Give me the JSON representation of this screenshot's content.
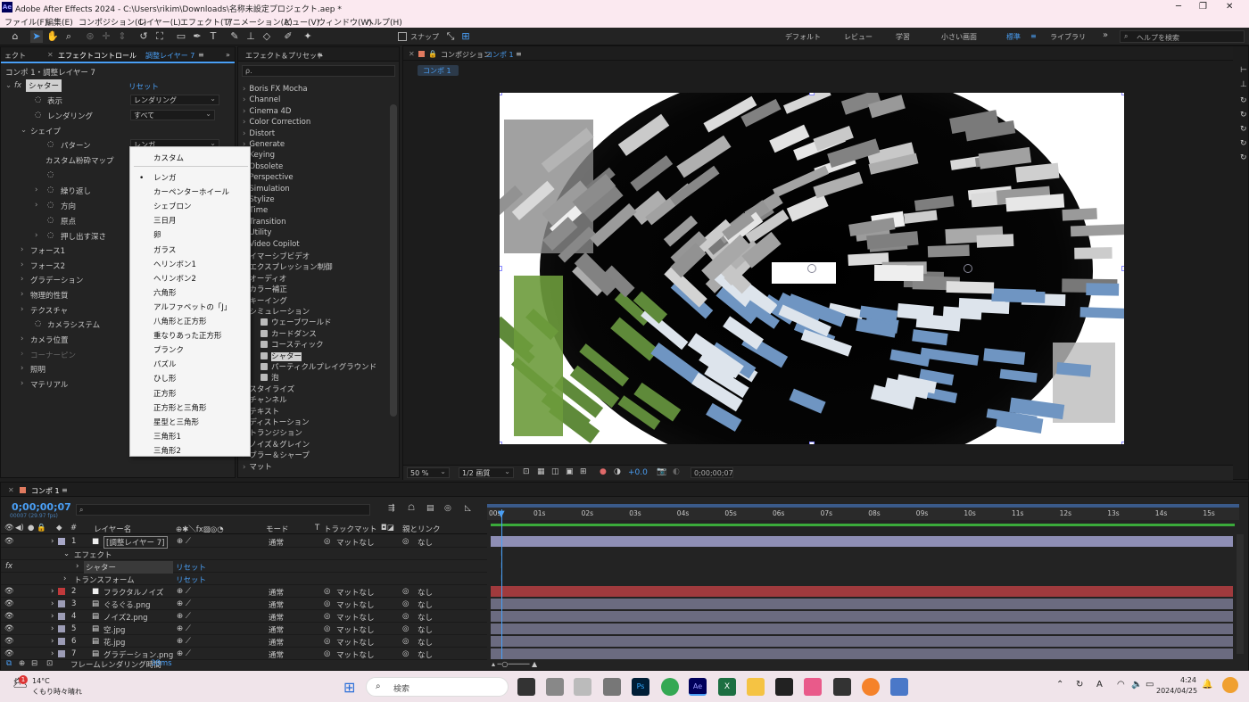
{
  "titlebar": {
    "title": "Adobe After Effects 2024 - C:\\Users\\rikim\\Downloads\\名称未設定プロジェクト.aep *",
    "logo": "Ae"
  },
  "menu": [
    "ファイル(F)",
    "編集(E)",
    "コンポジション(C)",
    "レイヤー(L)",
    "エフェクト(T)",
    "アニメーション(A)",
    "ビュー(V)",
    "ウィンドウ(W)",
    "ヘルプ(H)"
  ],
  "toolbar": {
    "snap": "スナップ",
    "workspaces": [
      "デフォルト",
      "レビュー",
      "学習",
      "小さい画面",
      "標準",
      "ライブラリ"
    ],
    "active_workspace": "標準",
    "help_placeholder": "ヘルプを検索"
  },
  "effect_controls": {
    "tab_left": "ェクト",
    "tab": "エフェクトコントロール",
    "tab_layer": "調整レイヤー 7",
    "header": "コンポ 1・調整レイヤー 7",
    "fx_name": "シャター",
    "reset": "リセット",
    "rows": [
      {
        "label": "表示",
        "value": "レンダリング"
      },
      {
        "label": "レンダリング",
        "value": "すべて"
      },
      {
        "label": "シェイプ"
      },
      {
        "label": "パターン",
        "value": "レンガ"
      },
      {
        "label": "カスタム粉砕マップ"
      },
      {
        "label": "繰り返し"
      },
      {
        "label": "方向"
      },
      {
        "label": "原点"
      },
      {
        "label": "押し出す深さ"
      },
      {
        "label": "フォース1"
      },
      {
        "label": "フォース2"
      },
      {
        "label": "グラデーション"
      },
      {
        "label": "物理的性質"
      },
      {
        "label": "テクスチャ"
      },
      {
        "label": "カメラシステム"
      },
      {
        "label": "カメラ位置"
      },
      {
        "label": "コーナーピン"
      },
      {
        "label": "照明"
      },
      {
        "label": "マテリアル"
      }
    ]
  },
  "pattern_menu": {
    "selected": "レンガ",
    "items": [
      "カスタム",
      "レンガ",
      "カーペンターホイール",
      "シェブロン",
      "三日月",
      "卵",
      "ガラス",
      "ヘリンボン1",
      "ヘリンボン2",
      "六角形",
      "アルファベットの「J」",
      "八角形と正方形",
      "重なりあった正方形",
      "プランク",
      "パズル",
      "ひし形",
      "正方形",
      "正方形と三角形",
      "星型と三角形",
      "三角形1",
      "三角形2"
    ]
  },
  "effects_presets": {
    "tab": "エフェクト＆プリセット",
    "search": "ρ.",
    "categories": [
      "Boris FX Mocha",
      "Channel",
      "Cinema 4D",
      "Color Correction",
      "Distort",
      "Generate",
      "Keying",
      "Obsolete",
      "Perspective",
      "Simulation",
      "Stylize",
      "Time",
      "Transition",
      "Utility",
      "Video Copilot",
      "イマーシブビデオ",
      "エクスプレッション制御",
      "オーディオ",
      "カラー補正",
      "キーイング",
      "シミュレーション"
    ],
    "sim_items": [
      "ウェーブワールド",
      "カードダンス",
      "コースティック",
      "シャター",
      "パーティクルプレイグラウンド",
      "泡"
    ],
    "more": [
      "スタイライズ",
      "チャンネル",
      "テキスト",
      "ディストーション",
      "トランジション",
      "ノイズ＆グレイン",
      "ブラー＆シャープ",
      "マット"
    ]
  },
  "composition": {
    "tab": "コンポジション",
    "comp_name": "コンポ 1",
    "subtab": "コンポ 1",
    "zoom": "50 %",
    "resolution": "1/2 画質",
    "exposure": "+0.0",
    "timecode": "0;00;00;07"
  },
  "timeline": {
    "tab": "コンポ 1",
    "timecode": "0;00;00;07",
    "fps": "00007 (29.97 fps)",
    "col_layer": "レイヤー名",
    "col_mode": "モード",
    "col_t": "T",
    "col_track": "トラックマット",
    "col_parent": "親とリンク",
    "ruler": [
      "00s",
      "01s",
      "02s",
      "03s",
      "04s",
      "05s",
      "06s",
      "07s",
      "08s",
      "09s",
      "10s",
      "11s",
      "12s",
      "13s",
      "14s",
      "15s"
    ],
    "layers": [
      {
        "num": "1",
        "name": "[調整レイヤー 7]",
        "mode": "通常",
        "track": "マットなし",
        "parent": "なし",
        "color": "#a8a8c8",
        "bar": "#8e8eb5"
      },
      {
        "num": "2",
        "name": "フラクタルノイズ",
        "mode": "通常",
        "track": "マットなし",
        "parent": "なし",
        "color": "#c0393b",
        "bar": "#a03a3d"
      },
      {
        "num": "3",
        "name": "ぐるぐる.png",
        "mode": "通常",
        "track": "マットなし",
        "parent": "なし",
        "color": "#9c9cb5",
        "bar": "#6b6b80"
      },
      {
        "num": "4",
        "name": "ノイズ2.png",
        "mode": "通常",
        "track": "マットなし",
        "parent": "なし",
        "color": "#9c9cb5",
        "bar": "#6b6b80"
      },
      {
        "num": "5",
        "name": "空.jpg",
        "mode": "通常",
        "track": "マットなし",
        "parent": "なし",
        "color": "#9c9cb5",
        "bar": "#6b6b80"
      },
      {
        "num": "6",
        "name": "花.jpg",
        "mode": "通常",
        "track": "マットなし",
        "parent": "なし",
        "color": "#9c9cb5",
        "bar": "#6b6b80"
      },
      {
        "num": "7",
        "name": "グラデーション.png",
        "mode": "通常",
        "track": "マットなし",
        "parent": "なし",
        "color": "#9c9cb5",
        "bar": "#6b6b80"
      }
    ],
    "effect_label": "エフェクト",
    "shatter": "シャター",
    "transform": "トランスフォーム",
    "reset": "リセット",
    "render_time_label": "フレームレンダリング時間",
    "render_time": "38ms"
  },
  "taskbar": {
    "temp": "14°C",
    "weather": "くもり時々晴れ",
    "search": "検索",
    "time": "4:24",
    "date": "2024/04/25",
    "lang": "A"
  }
}
